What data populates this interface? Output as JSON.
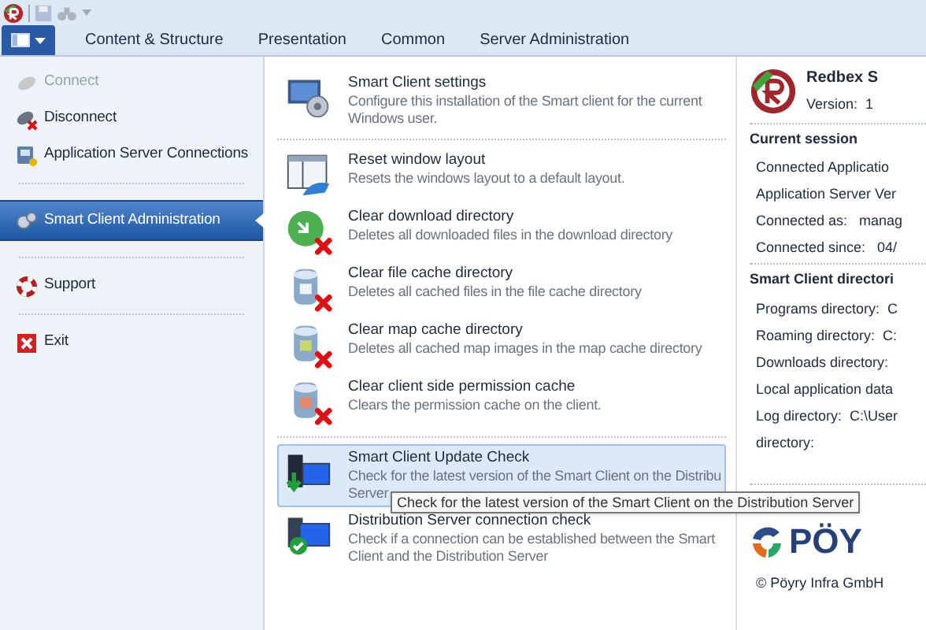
{
  "ribbon": {
    "tabs": [
      {
        "label": "Content & Structure",
        "selected": false
      },
      {
        "label": "Presentation",
        "selected": false
      },
      {
        "label": "Common",
        "selected": false
      },
      {
        "label": "Server Administration",
        "selected": false
      }
    ]
  },
  "sidebar": {
    "items": [
      {
        "kind": "item",
        "label": "Connect",
        "disabled": true,
        "selected": false
      },
      {
        "kind": "item",
        "label": "Disconnect",
        "disabled": false,
        "selected": false
      },
      {
        "kind": "item",
        "label": "Application Server Connections",
        "disabled": false,
        "selected": false
      },
      {
        "kind": "separator"
      },
      {
        "kind": "item",
        "label": "Smart Client Administration",
        "disabled": false,
        "selected": true
      },
      {
        "kind": "separator"
      },
      {
        "kind": "item",
        "label": "Support",
        "disabled": false,
        "selected": false
      },
      {
        "kind": "separator"
      },
      {
        "kind": "item",
        "label": "Exit",
        "disabled": false,
        "selected": false
      }
    ]
  },
  "actions": [
    {
      "kind": "action",
      "title": "Smart Client settings",
      "description": [
        "Configure this installation of the Smart client for the current",
        "Windows user."
      ],
      "selected": false
    },
    {
      "kind": "separator"
    },
    {
      "kind": "action",
      "title": "Reset window layout",
      "description": [
        "Resets the windows layout to a default layout."
      ],
      "selected": false
    },
    {
      "kind": "action",
      "title": "Clear download directory",
      "description": [
        "Deletes all downloaded files in the download directory"
      ],
      "selected": false
    },
    {
      "kind": "action",
      "title": "Clear file cache directory",
      "description": [
        "Deletes all cached files in the file cache directory"
      ],
      "selected": false
    },
    {
      "kind": "action",
      "title": "Clear map cache directory",
      "description": [
        "Deletes all cached map images in the map cache directory"
      ],
      "selected": false
    },
    {
      "kind": "action",
      "title": "Clear client side permission cache",
      "description": [
        "Clears the permission cache on the client."
      ],
      "selected": false
    },
    {
      "kind": "separator"
    },
    {
      "kind": "action",
      "title": "Smart Client Update Check",
      "description": [
        "Check for the latest version of the Smart Client on the Distribu",
        "Server"
      ],
      "selected": true
    },
    {
      "kind": "action",
      "title": "Distribution Server connection check",
      "description": [
        "Check if a connection can be established between the Smart",
        "Client and the Distribution Server"
      ],
      "selected": false
    }
  ],
  "tooltip": "Check for the latest version of the Smart Client on the Distribution Server",
  "info": {
    "product": "Redbex S",
    "version": "Version:  1",
    "sections": [
      {
        "heading": "Current session",
        "rows": [
          "Connected Applicatio",
          "Application Server Ver",
          "Connected as:   manag",
          "Connected since:   04/"
        ]
      },
      {
        "heading": "Smart Client directori",
        "rows": [
          "Programs directory:  C",
          "Roaming directory:  C:",
          "Downloads directory:",
          "Local application data",
          "Log directory:  C:\\User",
          "directory:"
        ]
      }
    ],
    "logo_text": "PÖY",
    "copyright": "© Pöyry Infra GmbH"
  }
}
